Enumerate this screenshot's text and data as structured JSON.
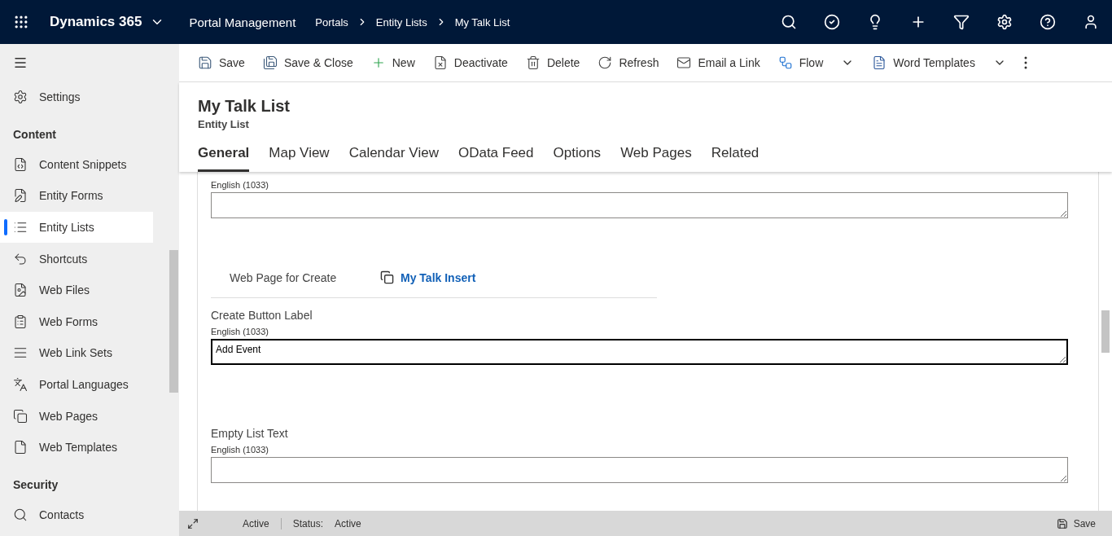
{
  "app_bar": {
    "app_name": "Dynamics 365",
    "area": "Portal Management",
    "breadcrumbs": [
      "Portals",
      "Entity Lists",
      "My Talk List"
    ]
  },
  "sidebar": {
    "items": [
      {
        "kind": "item",
        "label": "Settings",
        "selected": false
      },
      {
        "kind": "heading",
        "label": "Content"
      },
      {
        "kind": "item",
        "label": "Content Snippets",
        "selected": false
      },
      {
        "kind": "item",
        "label": "Entity Forms",
        "selected": false
      },
      {
        "kind": "item",
        "label": "Entity Lists",
        "selected": true
      },
      {
        "kind": "item",
        "label": "Shortcuts",
        "selected": false
      },
      {
        "kind": "item",
        "label": "Web Files",
        "selected": false
      },
      {
        "kind": "item",
        "label": "Web Forms",
        "selected": false
      },
      {
        "kind": "item",
        "label": "Web Link Sets",
        "selected": false
      },
      {
        "kind": "item",
        "label": "Portal Languages",
        "selected": false
      },
      {
        "kind": "item",
        "label": "Web Pages",
        "selected": false
      },
      {
        "kind": "item",
        "label": "Web Templates",
        "selected": false
      },
      {
        "kind": "heading",
        "label": "Security"
      },
      {
        "kind": "item",
        "label": "Contacts",
        "selected": false
      }
    ]
  },
  "commands": [
    {
      "label": "Save",
      "dropdown": false
    },
    {
      "label": "Save & Close",
      "dropdown": false
    },
    {
      "label": "New",
      "dropdown": false
    },
    {
      "label": "Deactivate",
      "dropdown": false
    },
    {
      "label": "Delete",
      "dropdown": false
    },
    {
      "label": "Refresh",
      "dropdown": false
    },
    {
      "label": "Email a Link",
      "dropdown": false
    },
    {
      "label": "Flow",
      "dropdown": true
    },
    {
      "label": "Word Templates",
      "dropdown": true
    }
  ],
  "record": {
    "title": "My Talk List",
    "entity": "Entity List"
  },
  "tabs": [
    {
      "label": "General",
      "selected": true
    },
    {
      "label": "Map View",
      "selected": false
    },
    {
      "label": "Calendar View",
      "selected": false
    },
    {
      "label": "OData Feed",
      "selected": false
    },
    {
      "label": "Options",
      "selected": false
    },
    {
      "label": "Web Pages",
      "selected": false
    },
    {
      "label": "Related",
      "selected": false
    }
  ],
  "form": {
    "fields": [
      {
        "kind": "localized",
        "language": "English (1033)",
        "focused": false
      },
      {
        "kind": "lookup",
        "label": "Web Page for Create",
        "value": "My Talk Insert"
      },
      {
        "kind": "localized",
        "label": "Create Button Label",
        "language": "English (1033)",
        "value": "Add Event",
        "focused": true
      },
      {
        "kind": "localized",
        "label": "Empty List Text",
        "language": "English (1033)",
        "focused": false
      }
    ]
  },
  "status_bar": {
    "state": "Active",
    "status_label": "Status:",
    "status": "Active",
    "save": "Save"
  }
}
